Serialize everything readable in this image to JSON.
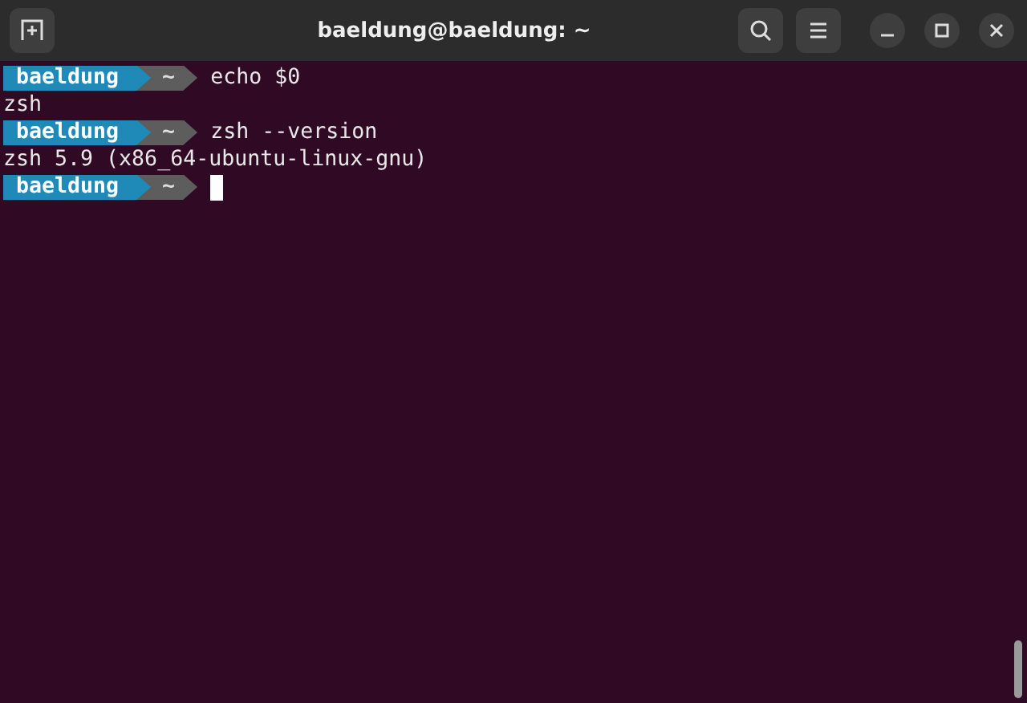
{
  "window": {
    "title": "baeldung@baeldung: ~"
  },
  "lines": [
    {
      "kind": "prompt",
      "user": "baeldung",
      "dir": "~",
      "command": "echo $0",
      "cursor": false
    },
    {
      "kind": "output",
      "text": "zsh"
    },
    {
      "kind": "prompt",
      "user": "baeldung",
      "dir": "~",
      "command": "zsh --version",
      "cursor": false
    },
    {
      "kind": "output",
      "text": "zsh 5.9 (x86_64-ubuntu-linux-gnu)"
    },
    {
      "kind": "prompt",
      "user": "baeldung",
      "dir": "~",
      "cursor": true
    }
  ]
}
